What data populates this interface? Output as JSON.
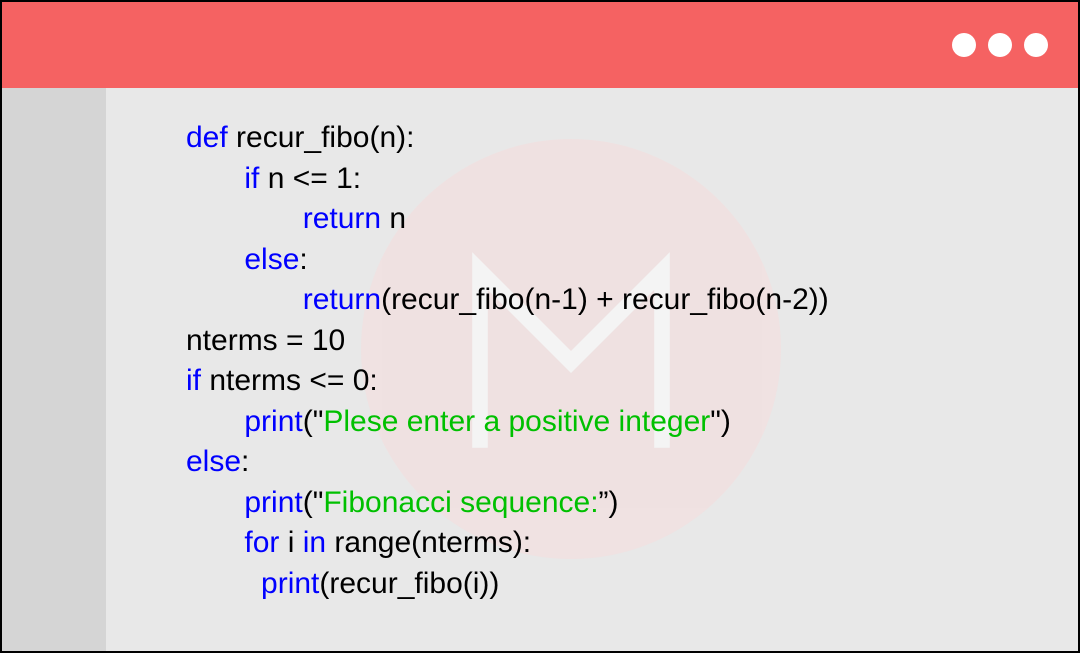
{
  "code": {
    "lines": [
      {
        "indent": 0,
        "tokens": [
          {
            "type": "kw",
            "text": "def"
          },
          {
            "type": "plain",
            "text": " recur_fibo(n):"
          }
        ]
      },
      {
        "indent": 1,
        "tokens": [
          {
            "type": "kw",
            "text": "if"
          },
          {
            "type": "plain",
            "text": " n <= 1:"
          }
        ]
      },
      {
        "indent": 2,
        "tokens": [
          {
            "type": "kw",
            "text": "return"
          },
          {
            "type": "plain",
            "text": " n"
          }
        ]
      },
      {
        "indent": 1,
        "tokens": [
          {
            "type": "kw",
            "text": "else"
          },
          {
            "type": "plain",
            "text": ":"
          }
        ]
      },
      {
        "indent": 2,
        "tokens": [
          {
            "type": "kw",
            "text": "return"
          },
          {
            "type": "plain",
            "text": "(recur_fibo(n-1) + recur_fibo(n-2))"
          }
        ]
      },
      {
        "indent": 0,
        "tokens": [
          {
            "type": "plain",
            "text": "nterms = 10"
          }
        ]
      },
      {
        "indent": 0,
        "tokens": [
          {
            "type": "kw",
            "text": "if"
          },
          {
            "type": "plain",
            "text": " nterms <= 0:"
          }
        ]
      },
      {
        "indent": 1,
        "tokens": [
          {
            "type": "kw",
            "text": "print"
          },
          {
            "type": "plain",
            "text": "(\""
          },
          {
            "type": "str",
            "text": "Plese enter a positive integer"
          },
          {
            "type": "plain",
            "text": "\")"
          }
        ]
      },
      {
        "indent": 0,
        "tokens": [
          {
            "type": "kw",
            "text": "else"
          },
          {
            "type": "plain",
            "text": ":"
          }
        ]
      },
      {
        "indent": 1,
        "tokens": [
          {
            "type": "kw",
            "text": "print"
          },
          {
            "type": "plain",
            "text": "(\""
          },
          {
            "type": "str",
            "text": "Fibonacci sequence:"
          },
          {
            "type": "plain",
            "text": "”)"
          }
        ]
      },
      {
        "indent": 1,
        "tokens": [
          {
            "type": "kw",
            "text": "for"
          },
          {
            "type": "plain",
            "text": " i "
          },
          {
            "type": "kw",
            "text": "in"
          },
          {
            "type": "plain",
            "text": " range(nterms):"
          }
        ]
      },
      {
        "indent": 1.3,
        "tokens": [
          {
            "type": "kw",
            "text": "print"
          },
          {
            "type": "plain",
            "text": "(recur_fibo(i))"
          }
        ]
      }
    ]
  }
}
